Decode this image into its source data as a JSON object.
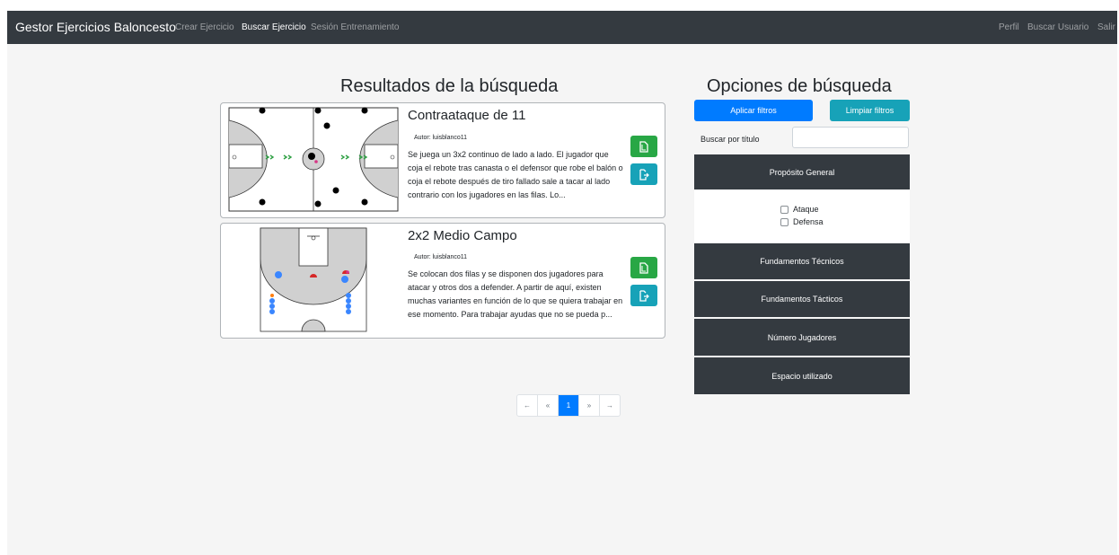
{
  "navbar": {
    "brand": "Gestor Ejercicios Baloncesto",
    "left_links": [
      "Crear Ejercicio",
      "Buscar Ejercicio",
      "Sesión Entrenamiento"
    ],
    "active_link": "Buscar Ejercicio",
    "right_links": [
      "Perfil",
      "Buscar Usuario",
      "Salir"
    ]
  },
  "results": {
    "heading": "Resultados de la búsqueda",
    "items": [
      {
        "title": "Contraataque de 11",
        "author": "Autor: luisblanco11",
        "description": "Se juega un 3x2 continuo de lado a lado. El jugador que coja el rebote tras canasta o el defensor que robe el balón o coja el rebote después de tiro fallado sale a tacar al lado contrario con los jugadores en las filas. Lo..."
      },
      {
        "title": "2x2 Medio Campo",
        "author": "Autor: luisblanco11",
        "description": "Se colocan dos filas y se disponen dos jugadores para atacar y otros dos a defender. A partir de aquí, existen muchas variantes en función de lo que se quiera trabajar en ese momento. Para trabajar ayudas que no se pueda p..."
      }
    ]
  },
  "pagination": {
    "first": "←",
    "prev": "«",
    "current": "1",
    "next": "»",
    "last": "→"
  },
  "filters": {
    "heading": "Opciones de búsqueda",
    "apply_label": "Aplicar filtros",
    "clear_label": "Limpiar filtros",
    "title_search_label": "Buscar por título",
    "title_search_value": "",
    "sections": [
      "Propósito General",
      "Fundamentos Técnicos",
      "Fundamentos Tácticos",
      "Número Jugadores",
      "Espacio utilizado"
    ],
    "general_purpose_options": [
      "Ataque",
      "Defensa"
    ]
  },
  "colors": {
    "navbar": "#343a40",
    "primary": "#007bff",
    "info": "#17a2b8",
    "success": "#28a745"
  },
  "icons": {
    "copy_button": "document-icon",
    "export_button": "export-icon"
  }
}
